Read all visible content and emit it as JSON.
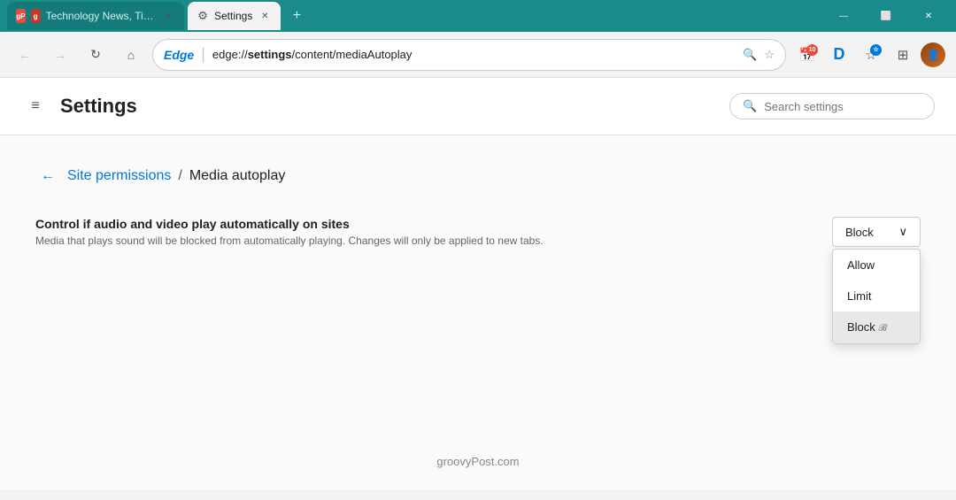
{
  "titlebar": {
    "tabs": [
      {
        "id": "tab-news",
        "label": "Technology News, Tips, Reviews...",
        "favicon_type": "gp",
        "active": false
      },
      {
        "id": "tab-settings",
        "label": "Settings",
        "favicon_type": "gear",
        "active": true
      }
    ],
    "new_tab_label": "+",
    "window_controls": {
      "minimize": "—",
      "maximize": "⬜",
      "close": "✕"
    }
  },
  "addressbar": {
    "back_tooltip": "Back",
    "forward_tooltip": "Forward",
    "refresh_tooltip": "Refresh",
    "home_tooltip": "Home",
    "edge_label": "Edge",
    "url_prefix": "edge://",
    "url_bold": "settings",
    "url_suffix": "/content/mediaAutoplay",
    "search_icon": "🔍",
    "favorites_icon": "☆",
    "calendar_icon": "📅",
    "profile_icon": "D",
    "collections_icon": "⊞",
    "favorites_bar_icon": "☆",
    "calendar_badge": "10"
  },
  "settings": {
    "hamburger_label": "≡",
    "title": "Settings",
    "search_placeholder": "Search settings"
  },
  "content": {
    "back_arrow": "←",
    "breadcrumb_link": "Site permissions",
    "breadcrumb_separator": "/",
    "breadcrumb_current": "Media autoplay",
    "setting_label": "Control if audio and video play automatically on sites",
    "setting_desc": "Media that plays sound will be blocked from automatically playing. Changes will only be applied to new tabs.",
    "dropdown": {
      "current_value": "Block",
      "chevron": "∨",
      "options": [
        {
          "label": "Allow",
          "value": "allow"
        },
        {
          "label": "Limit",
          "value": "limit"
        },
        {
          "label": "Block",
          "value": "block",
          "active": true
        }
      ]
    }
  },
  "footer": {
    "text": "groovyPost.com"
  }
}
